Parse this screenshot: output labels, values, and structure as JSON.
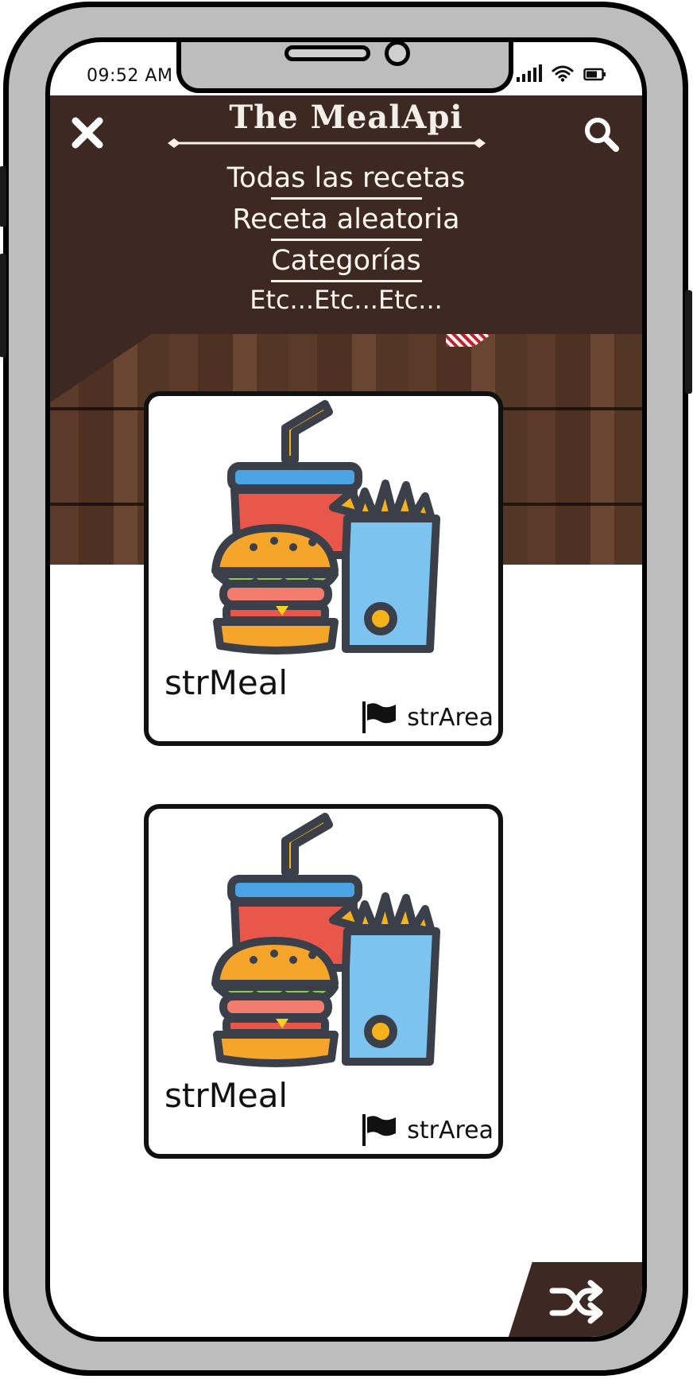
{
  "status_bar": {
    "time": "09:52 AM",
    "icons": [
      "signal-icon",
      "wifi-icon",
      "battery-icon"
    ]
  },
  "header": {
    "title": "The MealApi",
    "menu": [
      {
        "label": "Todas las recetas"
      },
      {
        "label": "Receta aleatoria"
      },
      {
        "label": "Categorías"
      },
      {
        "label": "Etc...Etc...Etc..."
      }
    ],
    "icons": [
      "close-icon",
      "search-icon"
    ]
  },
  "meals": [
    {
      "name": "strMeal",
      "area": "strArea",
      "icon": "fast-food-icon"
    },
    {
      "name": "strMeal",
      "area": "strArea",
      "icon": "fast-food-icon"
    }
  ],
  "shuffle_button": {
    "icon": "shuffle-icon"
  },
  "colors": {
    "header_bg": "#3d2822",
    "wood": "#5b3a2a",
    "card_border": "#111111",
    "cup_red": "#e9574a",
    "lid_blue": "#4aa3e3",
    "fries_yellow": "#f6b21b",
    "fries_box": "#7cc4ef",
    "bun": "#f5a62a"
  }
}
